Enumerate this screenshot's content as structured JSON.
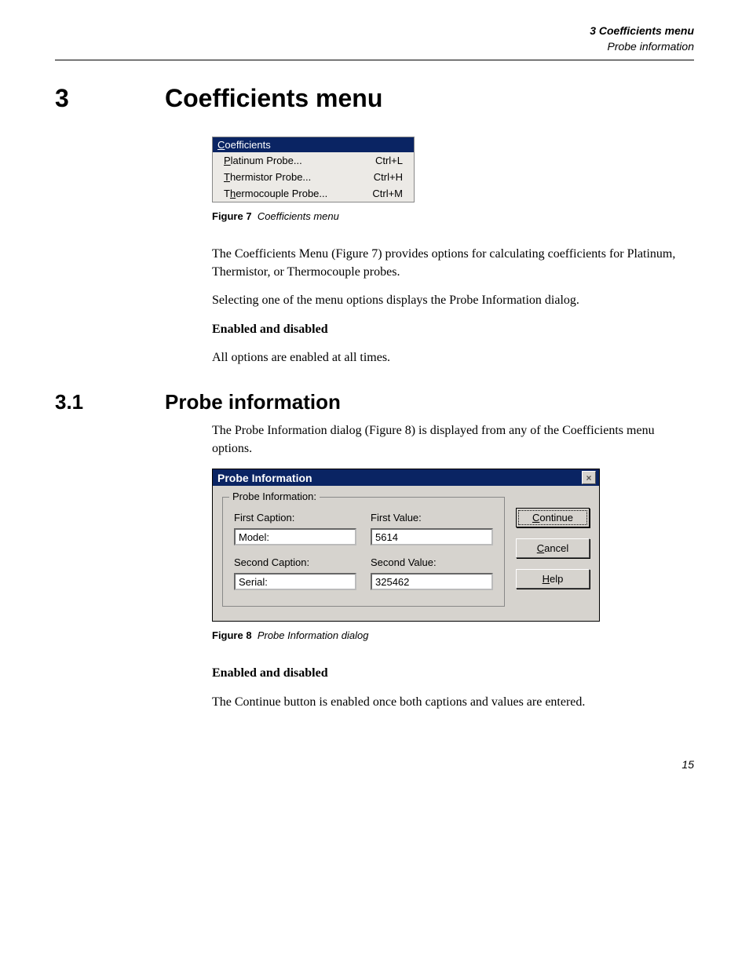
{
  "header": {
    "line1": "3  Coefficients menu",
    "line2": "Probe information"
  },
  "chapter": {
    "num": "3",
    "title": "Coefficients menu"
  },
  "menu": {
    "title": "Coefficients",
    "items": [
      {
        "prefix": "P",
        "rest": "latinum Probe...",
        "accel": "Ctrl+L"
      },
      {
        "prefix": "T",
        "rest": "hermistor Probe...",
        "accel": "Ctrl+H"
      },
      {
        "prefix_plain": "T",
        "prefix": "h",
        "rest": "ermocouple Probe...",
        "accel": "Ctrl+M"
      }
    ]
  },
  "fig7": {
    "label": "Figure 7",
    "caption": "Coefficients menu"
  },
  "para1": "The Coefficients Menu (Figure 7) provides options for calculating coefficients for Platinum, Thermistor, or Thermocouple probes.",
  "para2": "Selecting one of the menu options displays the Probe Information dialog.",
  "enabled_heading": "Enabled and disabled",
  "para3": "All options are enabled at all times.",
  "section": {
    "num": "3.1",
    "title": "Probe information"
  },
  "para4": "The Probe Information dialog (Figure 8) is displayed from any of the Coefficients menu options.",
  "dialog": {
    "title": "Probe Information",
    "group_legend": "Probe Information:",
    "first_caption_label": "First Caption:",
    "first_value_label": "First Value:",
    "first_caption_value": "Model:",
    "first_value_value": "5614",
    "second_caption_label": "Second Caption:",
    "second_value_label": "Second Value:",
    "second_caption_value": "Serial:",
    "second_value_value": "325462",
    "buttons": {
      "continue_u": "C",
      "continue_pre": "",
      "continue_rest": "ontinue",
      "cancel_u": "C",
      "cancel_rest": "ancel",
      "help_u": "H",
      "help_rest": "elp"
    }
  },
  "fig8": {
    "label": "Figure 8",
    "caption": "Probe Information dialog"
  },
  "para5_heading": "Enabled and disabled",
  "para5": "The Continue button is enabled once both captions and values are entered.",
  "page_number": "15"
}
